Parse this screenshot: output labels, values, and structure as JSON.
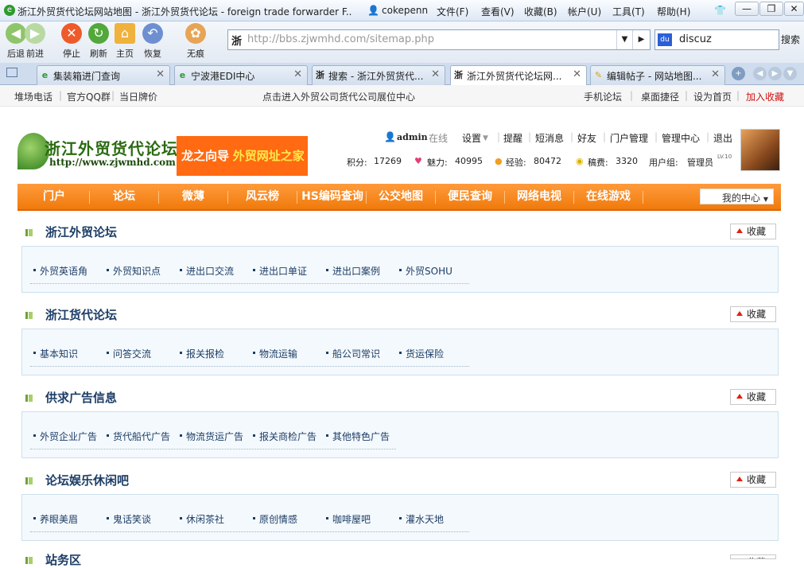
{
  "window": {
    "title": "浙江外贸货代论坛网站地图 - 浙江外贸货代论坛 - foreign trade forwarder F...",
    "user": "cokepenn",
    "menu": [
      "文件(F)",
      "查看(V)",
      "收藏(B)",
      "帐户(U)",
      "工具(T)",
      "帮助(H)"
    ],
    "controls": [
      "—",
      "❐",
      "✕"
    ]
  },
  "toolbar": {
    "buttons": [
      "后退",
      "前进",
      "停止",
      "刷新",
      "主页",
      "恢复",
      "无痕"
    ],
    "address": "http://bbs.zjwmhd.com/sitemap.php",
    "address_favicon": "浙",
    "search_value": "discuz",
    "search_button": "搜索"
  },
  "tabs": [
    {
      "label": "集装箱进门查询",
      "icon": "e"
    },
    {
      "label": "宁波港EDI中心",
      "icon": "e"
    },
    {
      "label": "搜索 - 浙江外贸货代...",
      "icon": "浙"
    },
    {
      "label": "浙江外贸货代论坛网...",
      "icon": "浙"
    },
    {
      "label": "编辑帖子 - 网站地图...",
      "icon": "✎"
    }
  ],
  "topstrip": {
    "left": [
      "堆场电话",
      "官方QQ群",
      "当日牌价"
    ],
    "center": "点击进入外贸公司货代公司展位中心",
    "right": [
      "手机论坛",
      "桌面捷径",
      "设为首页",
      "加入收藏"
    ]
  },
  "header": {
    "logo_cn": "浙江外贸货代论坛",
    "logo_url": "http://www.zjwmhd.com",
    "banner_a": "龙之向导",
    "banner_b": "外贸网址之家",
    "username": "admin",
    "online": "在线",
    "user_links": [
      "设置",
      "提醒",
      "短消息",
      "好友",
      "门户管理",
      "管理中心",
      "退出"
    ],
    "stats": {
      "points_label": "积分:",
      "points": "17269",
      "charm_label": "魅力:",
      "charm": "40995",
      "exp_label": "经验:",
      "exp": "80472",
      "fee_label": "稿费:",
      "fee": "3320",
      "group_label": "用户组:",
      "group": "管理员",
      "level": "LV.10"
    }
  },
  "nav": {
    "items": [
      "门户",
      "论坛",
      "微薄",
      "风云榜",
      "HS编码查询",
      "公交地图",
      "便民查询",
      "网络电视",
      "在线游戏"
    ],
    "my_center": "我的中心"
  },
  "sections": [
    {
      "title": "浙江外贸论坛",
      "fav": "收藏",
      "links": [
        "外贸英语角",
        "外贸知识点",
        "进出口交流",
        "进出口单证",
        "进出口案例",
        "外贸SOHU"
      ]
    },
    {
      "title": "浙江货代论坛",
      "fav": "收藏",
      "links": [
        "基本知识",
        "问答交流",
        "报关报检",
        "物流运输",
        "船公司常识",
        "货运保险"
      ]
    },
    {
      "title": "供求广告信息",
      "fav": "收藏",
      "links": [
        "外贸企业广告",
        "货代船代广告",
        "物流货运广告",
        "报关商检广告",
        "其他特色广告"
      ]
    },
    {
      "title": "论坛娱乐休闲吧",
      "fav": "收藏",
      "links": [
        "养眼美眉",
        "鬼话笑谈",
        "休闲茶社",
        "原创情感",
        "咖啡屋吧",
        "灌水天地"
      ]
    },
    {
      "title": "站务区",
      "fav": "收藏",
      "links": []
    }
  ]
}
